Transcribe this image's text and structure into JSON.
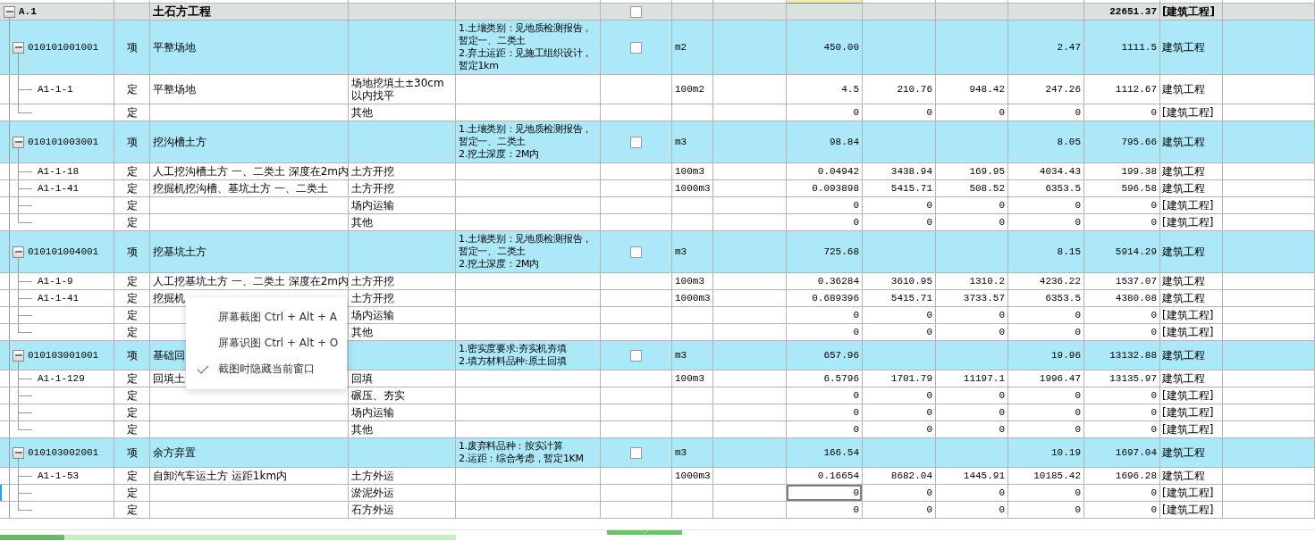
{
  "table": {
    "group": {
      "code": "A.1",
      "name": "土石方工程",
      "checked": false,
      "amount": "22651.37",
      "category": "[建筑工程]",
      "expanded": true,
      "children": [
        {
          "code": "010101001001",
          "type": "项",
          "name": "平整场地",
          "description": [
            "1.土壤类别：见地质检测报告，暂定一、二类土",
            "2.弃土运距：见施工组织设计，暂定1km"
          ],
          "checked": false,
          "unit": "m2",
          "quantity": "450.00",
          "column_12": "2.47",
          "amount": "1111.5",
          "category": "建筑工程",
          "expanded": true,
          "selected": false,
          "children": [
            {
              "code": "A1-1-1",
              "type": "定",
              "name": "平整场地",
              "feature": "场地挖填土±30cm以内找平",
              "unit": "100m2",
              "quantity": "4.5",
              "column_10": "210.76",
              "column_11": "948.42",
              "column_12": "247.26",
              "amount": "1112.67",
              "category": "建筑工程",
              "selected": false
            },
            {
              "type": "定",
              "feature": "其他",
              "quantity": "0",
              "column_10": "0",
              "column_11": "0",
              "column_12": "0",
              "amount": "0",
              "category": "[建筑工程]",
              "selected": false
            }
          ]
        },
        {
          "code": "010101003001",
          "type": "项",
          "name": "挖沟槽土方",
          "description": [
            "1.土壤类别：见地质检测报告，暂定一、二类土",
            "2.挖土深度：2M内"
          ],
          "checked": false,
          "unit": "m3",
          "quantity": "98.84",
          "column_12": "8.05",
          "amount": "795.66",
          "category": "建筑工程",
          "expanded": true,
          "selected": false,
          "children": [
            {
              "code": "A1-1-18",
              "type": "定",
              "name": "人工挖沟槽土方 一、二类土 深度在2m内",
              "feature": "土方开挖",
              "unit": "100m3",
              "quantity": "0.04942",
              "column_10": "3438.94",
              "column_11": "169.95",
              "column_12": "4034.43",
              "amount": "199.38",
              "category": "建筑工程",
              "selected": false
            },
            {
              "code": "A1-1-41",
              "type": "定",
              "name": "挖掘机挖沟槽、基坑土方 一、二类土",
              "feature": "土方开挖",
              "unit": "1000m3",
              "quantity": "0.093898",
              "column_10": "5415.71",
              "column_11": "508.52",
              "column_12": "6353.5",
              "amount": "596.58",
              "category": "建筑工程",
              "selected": false
            },
            {
              "type": "定",
              "feature": "场内运输",
              "quantity": "0",
              "column_10": "0",
              "column_11": "0",
              "column_12": "0",
              "amount": "0",
              "category": "[建筑工程]",
              "selected": false
            },
            {
              "type": "定",
              "feature": "其他",
              "quantity": "0",
              "column_10": "0",
              "column_11": "0",
              "column_12": "0",
              "amount": "0",
              "category": "[建筑工程]",
              "selected": false
            }
          ]
        },
        {
          "code": "010101004001",
          "type": "项",
          "name": "挖基坑土方",
          "description": [
            "1.土壤类别：见地质检测报告，暂定一、二类土",
            "2.挖土深度：2M内"
          ],
          "checked": false,
          "unit": "m3",
          "quantity": "725.68",
          "column_12": "8.15",
          "amount": "5914.29",
          "category": "建筑工程",
          "expanded": true,
          "selected": false,
          "children": [
            {
              "code": "A1-1-9",
              "type": "定",
              "name": "人工挖基坑土方 一、二类土 深度在2m内",
              "feature": "土方开挖",
              "unit": "100m3",
              "quantity": "0.36284",
              "column_10": "3610.95",
              "column_11": "1310.2",
              "column_12": "4236.22",
              "amount": "1537.07",
              "category": "建筑工程",
              "selected": false
            },
            {
              "code": "A1-1-41",
              "type": "定",
              "name": "挖掘机",
              "feature": "土方开挖",
              "unit": "1000m3",
              "quantity": "0.689396",
              "column_10": "5415.71",
              "column_11": "3733.57",
              "column_12": "6353.5",
              "amount": "4380.08",
              "category": "建筑工程",
              "selected": false
            },
            {
              "type": "定",
              "feature": "场内运输",
              "quantity": "0",
              "column_10": "0",
              "column_11": "0",
              "column_12": "0",
              "amount": "0",
              "category": "[建筑工程]",
              "selected": false
            },
            {
              "type": "定",
              "feature": "其他",
              "quantity": "0",
              "column_10": "0",
              "column_11": "0",
              "column_12": "0",
              "amount": "0",
              "category": "[建筑工程]",
              "selected": false
            }
          ]
        },
        {
          "code": "010103001001",
          "type": "项",
          "name": "基础回",
          "description": [
            "1.密实度要求:夯实机夯填",
            "2.填方材料品种:原土回填"
          ],
          "checked": false,
          "unit": "m3",
          "quantity": "657.96",
          "column_12": "19.96",
          "amount": "13132.88",
          "category": "建筑工程",
          "expanded": true,
          "selected": false,
          "children": [
            {
              "code": "A1-1-129",
              "type": "定",
              "name": "回填土",
              "feature": "回填",
              "unit": "100m3",
              "quantity": "6.5796",
              "column_10": "1701.79",
              "column_11": "11197.1",
              "column_12": "1996.47",
              "amount": "13135.97",
              "category": "建筑工程",
              "selected": false
            },
            {
              "type": "定",
              "feature": "碾压、夯实",
              "quantity": "0",
              "column_10": "0",
              "column_11": "0",
              "column_12": "0",
              "amount": "0",
              "category": "[建筑工程]",
              "selected": false
            },
            {
              "type": "定",
              "feature": "场内运输",
              "quantity": "0",
              "column_10": "0",
              "column_11": "0",
              "column_12": "0",
              "amount": "0",
              "category": "[建筑工程]",
              "selected": false
            },
            {
              "type": "定",
              "feature": "其他",
              "quantity": "0",
              "column_10": "0",
              "column_11": "0",
              "column_12": "0",
              "amount": "0",
              "category": "[建筑工程]",
              "selected": false
            }
          ]
        },
        {
          "code": "010103002001",
          "type": "项",
          "name": "余方弃置",
          "description": [
            "1.废弃料品种：按实计算",
            "2.运距：综合考虑，暂定1KM"
          ],
          "checked": false,
          "unit": "m3",
          "quantity": "166.54",
          "column_12": "10.19",
          "amount": "1697.04",
          "category": "建筑工程",
          "expanded": true,
          "selected": false,
          "children": [
            {
              "code": "A1-1-53",
              "type": "定",
              "name": "自卸汽车运土方 运距1km内",
              "feature": "土方外运",
              "unit": "1000m3",
              "quantity": "0.16654",
              "column_10": "8682.04",
              "column_11": "1445.91",
              "column_12": "10185.42",
              "amount": "1696.28",
              "category": "建筑工程",
              "selected": false
            },
            {
              "type": "定",
              "feature": "淤泥外运",
              "quantity": "0",
              "column_10": "0",
              "column_11": "0",
              "column_12": "0",
              "amount": "0",
              "category": "[建筑工程]",
              "selected": true
            },
            {
              "type": "定",
              "feature": "石方外运",
              "quantity": "0",
              "column_10": "0",
              "column_11": "0",
              "column_12": "0",
              "amount": "0",
              "category": "[建筑工程]",
              "selected": false
            }
          ]
        }
      ]
    }
  },
  "context_menu": {
    "items": [
      {
        "label": "屏幕截图 Ctrl + Alt + A",
        "checked": false
      },
      {
        "label": "屏幕识图 Ctrl + Alt + O",
        "checked": false
      },
      {
        "label": "截图时隐藏当前窗口",
        "checked": true
      }
    ]
  }
}
